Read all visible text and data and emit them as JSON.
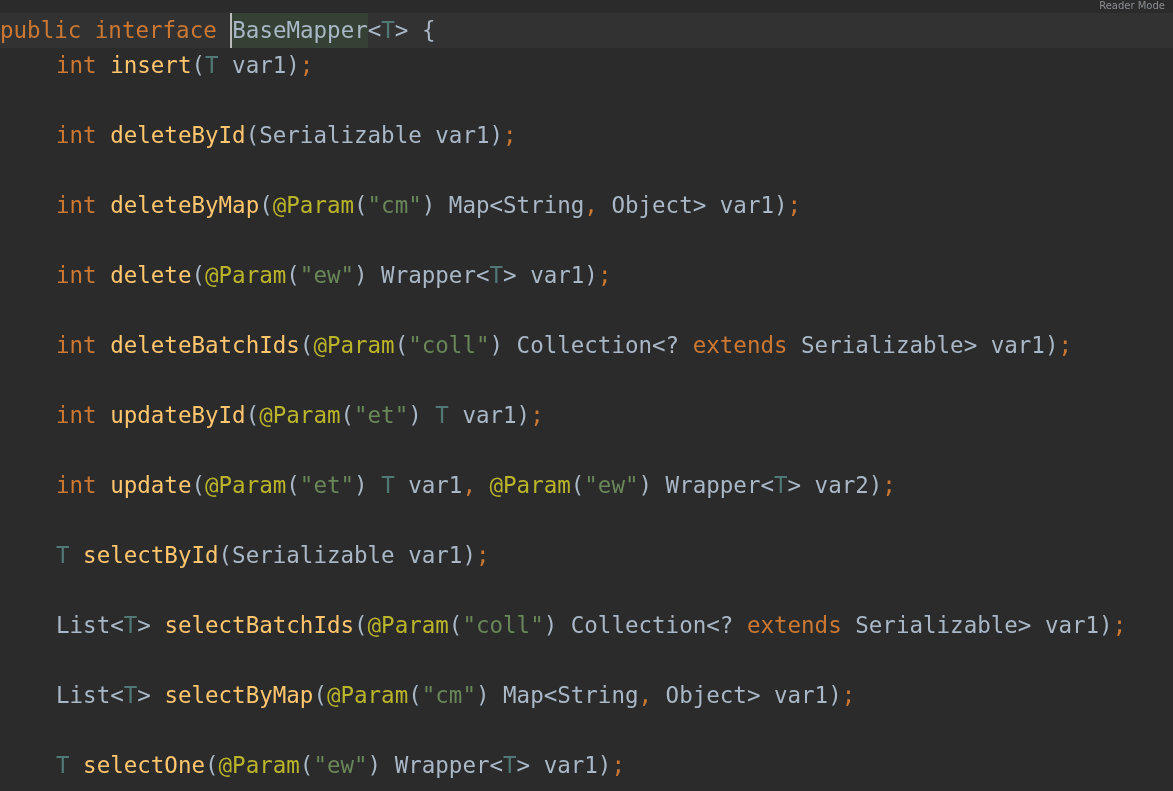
{
  "reader_mode": "Reader Mode",
  "editor": {
    "lines": [
      {
        "tokens": [
          {
            "kind": "kw",
            "text": "public interface "
          },
          {
            "kind": "plain",
            "text": "BaseMapper",
            "highlighted": true
          },
          {
            "kind": "plain",
            "text": "<"
          },
          {
            "kind": "tp",
            "text": "T"
          },
          {
            "kind": "plain",
            "text": "> {"
          }
        ],
        "children": [
          {
            "tokens": [
              {
                "kind": "kw",
                "text": "int "
              },
              {
                "kind": "method",
                "text": "insert"
              },
              {
                "kind": "plain",
                "text": "("
              },
              {
                "kind": "tp",
                "text": "T"
              },
              {
                "kind": "plain",
                "text": " var1)"
              },
              {
                "kind": "punct",
                "text": ";"
              }
            ]
          },
          {
            "tokens": [
              {
                "kind": "kw",
                "text": "int "
              },
              {
                "kind": "method",
                "text": "deleteById"
              },
              {
                "kind": "plain",
                "text": "(Serializable var1)"
              },
              {
                "kind": "punct",
                "text": ";"
              }
            ]
          },
          {
            "tokens": [
              {
                "kind": "kw",
                "text": "int "
              },
              {
                "kind": "method",
                "text": "deleteByMap"
              },
              {
                "kind": "plain",
                "text": "("
              },
              {
                "kind": "ann",
                "text": "@Param"
              },
              {
                "kind": "plain",
                "text": "("
              },
              {
                "kind": "str",
                "text": "\"cm\""
              },
              {
                "kind": "plain",
                "text": ") Map<String"
              },
              {
                "kind": "punct",
                "text": ","
              },
              {
                "kind": "plain",
                "text": " Object> var1)"
              },
              {
                "kind": "punct",
                "text": ";"
              }
            ]
          },
          {
            "tokens": [
              {
                "kind": "kw",
                "text": "int "
              },
              {
                "kind": "method",
                "text": "delete"
              },
              {
                "kind": "plain",
                "text": "("
              },
              {
                "kind": "ann",
                "text": "@Param"
              },
              {
                "kind": "plain",
                "text": "("
              },
              {
                "kind": "str",
                "text": "\"ew\""
              },
              {
                "kind": "plain",
                "text": ") Wrapper<"
              },
              {
                "kind": "tp",
                "text": "T"
              },
              {
                "kind": "plain",
                "text": "> var1)"
              },
              {
                "kind": "punct",
                "text": ";"
              }
            ]
          },
          {
            "tokens": [
              {
                "kind": "kw",
                "text": "int "
              },
              {
                "kind": "method",
                "text": "deleteBatchIds"
              },
              {
                "kind": "plain",
                "text": "("
              },
              {
                "kind": "ann",
                "text": "@Param"
              },
              {
                "kind": "plain",
                "text": "("
              },
              {
                "kind": "str",
                "text": "\"coll\""
              },
              {
                "kind": "plain",
                "text": ") Collection<? "
              },
              {
                "kind": "kw",
                "text": "extends"
              },
              {
                "kind": "plain",
                "text": " Serializable> var1)"
              },
              {
                "kind": "punct",
                "text": ";"
              }
            ]
          },
          {
            "tokens": [
              {
                "kind": "kw",
                "text": "int "
              },
              {
                "kind": "method",
                "text": "updateById"
              },
              {
                "kind": "plain",
                "text": "("
              },
              {
                "kind": "ann",
                "text": "@Param"
              },
              {
                "kind": "plain",
                "text": "("
              },
              {
                "kind": "str",
                "text": "\"et\""
              },
              {
                "kind": "plain",
                "text": ") "
              },
              {
                "kind": "tp",
                "text": "T"
              },
              {
                "kind": "plain",
                "text": " var1)"
              },
              {
                "kind": "punct",
                "text": ";"
              }
            ]
          },
          {
            "tokens": [
              {
                "kind": "kw",
                "text": "int "
              },
              {
                "kind": "method",
                "text": "update"
              },
              {
                "kind": "plain",
                "text": "("
              },
              {
                "kind": "ann",
                "text": "@Param"
              },
              {
                "kind": "plain",
                "text": "("
              },
              {
                "kind": "str",
                "text": "\"et\""
              },
              {
                "kind": "plain",
                "text": ") "
              },
              {
                "kind": "tp",
                "text": "T"
              },
              {
                "kind": "plain",
                "text": " var1"
              },
              {
                "kind": "punct",
                "text": ", "
              },
              {
                "kind": "ann",
                "text": "@Param"
              },
              {
                "kind": "plain",
                "text": "("
              },
              {
                "kind": "str",
                "text": "\"ew\""
              },
              {
                "kind": "plain",
                "text": ") Wrapper<"
              },
              {
                "kind": "tp",
                "text": "T"
              },
              {
                "kind": "plain",
                "text": "> var2)"
              },
              {
                "kind": "punct",
                "text": ";"
              }
            ]
          },
          {
            "tokens": [
              {
                "kind": "tp",
                "text": "T "
              },
              {
                "kind": "method",
                "text": "selectById"
              },
              {
                "kind": "plain",
                "text": "(Serializable var1)"
              },
              {
                "kind": "punct",
                "text": ";"
              }
            ]
          },
          {
            "tokens": [
              {
                "kind": "plain",
                "text": "List<"
              },
              {
                "kind": "tp",
                "text": "T"
              },
              {
                "kind": "plain",
                "text": "> "
              },
              {
                "kind": "method",
                "text": "selectBatchIds"
              },
              {
                "kind": "plain",
                "text": "("
              },
              {
                "kind": "ann",
                "text": "@Param"
              },
              {
                "kind": "plain",
                "text": "("
              },
              {
                "kind": "str",
                "text": "\"coll\""
              },
              {
                "kind": "plain",
                "text": ") Collection<? "
              },
              {
                "kind": "kw",
                "text": "extends"
              },
              {
                "kind": "plain",
                "text": " Serializable> var1)"
              },
              {
                "kind": "punct",
                "text": ";"
              }
            ]
          },
          {
            "tokens": [
              {
                "kind": "plain",
                "text": "List<"
              },
              {
                "kind": "tp",
                "text": "T"
              },
              {
                "kind": "plain",
                "text": "> "
              },
              {
                "kind": "method",
                "text": "selectByMap"
              },
              {
                "kind": "plain",
                "text": "("
              },
              {
                "kind": "ann",
                "text": "@Param"
              },
              {
                "kind": "plain",
                "text": "("
              },
              {
                "kind": "str",
                "text": "\"cm\""
              },
              {
                "kind": "plain",
                "text": ") Map<String"
              },
              {
                "kind": "punct",
                "text": ","
              },
              {
                "kind": "plain",
                "text": " Object> var1)"
              },
              {
                "kind": "punct",
                "text": ";"
              }
            ]
          },
          {
            "tokens": [
              {
                "kind": "tp",
                "text": "T "
              },
              {
                "kind": "method",
                "text": "selectOne"
              },
              {
                "kind": "plain",
                "text": "("
              },
              {
                "kind": "ann",
                "text": "@Param"
              },
              {
                "kind": "plain",
                "text": "("
              },
              {
                "kind": "str",
                "text": "\"ew\""
              },
              {
                "kind": "plain",
                "text": ") Wrapper<"
              },
              {
                "kind": "tp",
                "text": "T"
              },
              {
                "kind": "plain",
                "text": "> var1)"
              },
              {
                "kind": "punct",
                "text": ";"
              }
            ]
          }
        ]
      }
    ]
  }
}
